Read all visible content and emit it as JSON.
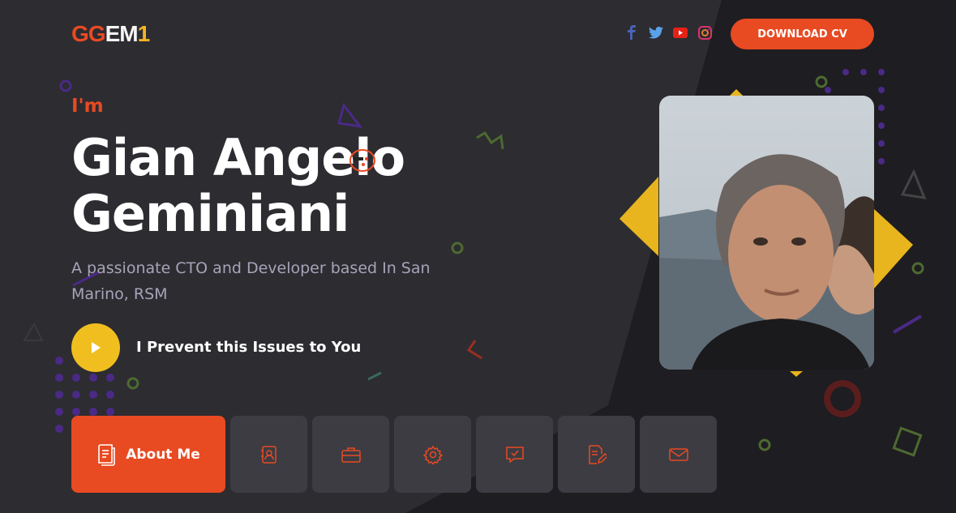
{
  "header": {
    "logo": {
      "part1": "GG",
      "part2": "EM",
      "part3": "1"
    },
    "social_icons": [
      "facebook-icon",
      "twitter-icon",
      "youtube-icon",
      "instagram-icon"
    ],
    "download_label": "DOWNLOAD CV"
  },
  "hero": {
    "intro": "I'm",
    "name_line1": "Gian Angelo",
    "name_line2": "Geminiani",
    "subtitle": "A passionate CTO and Developer based In San Marino, RSM",
    "cta_label": "I Prevent this Issues to You"
  },
  "nav": {
    "items": [
      {
        "icon": "resume-icon",
        "label": "About Me",
        "active": true
      },
      {
        "icon": "contact-card-icon",
        "label": "",
        "active": false
      },
      {
        "icon": "briefcase-icon",
        "label": "",
        "active": false
      },
      {
        "icon": "gear-icon",
        "label": "",
        "active": false
      },
      {
        "icon": "chat-check-icon",
        "label": "",
        "active": false
      },
      {
        "icon": "document-edit-icon",
        "label": "",
        "active": false
      },
      {
        "icon": "mail-icon",
        "label": "",
        "active": false
      }
    ]
  },
  "colors": {
    "accent": "#e84a22",
    "yellow": "#f0bf1f",
    "background": "#2d2c31",
    "panel": "#3d3c42",
    "text_muted": "#a8a3b9"
  }
}
